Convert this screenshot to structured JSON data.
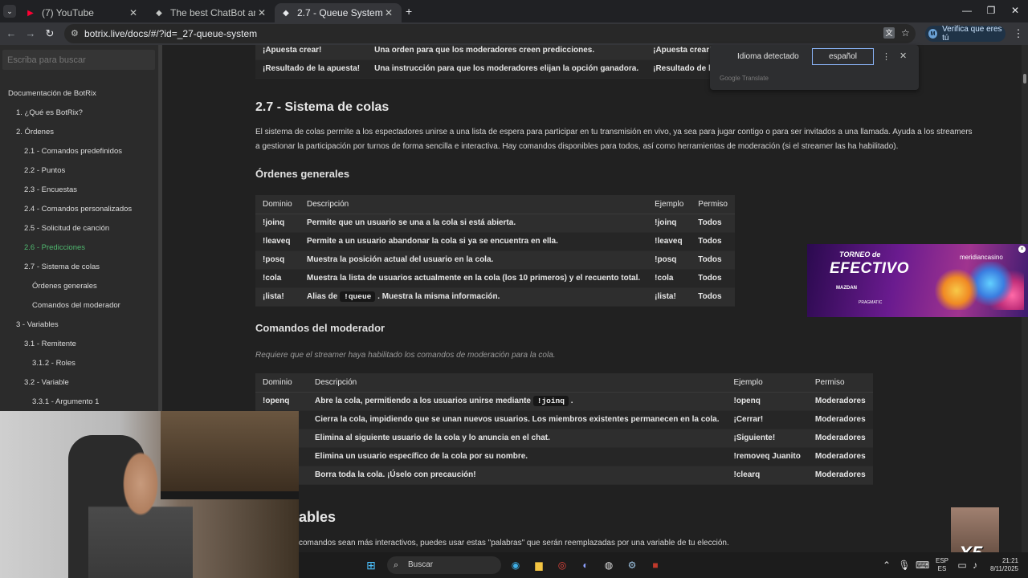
{
  "browser": {
    "tabs": [
      {
        "title": "(7) YouTube",
        "favicon": "youtube-icon",
        "active": false
      },
      {
        "title": "The best ChatBot and Widgets",
        "favicon": "botrix-icon",
        "active": false
      },
      {
        "title": "2.7 - Queue System",
        "favicon": "botrix-icon",
        "active": true
      }
    ],
    "url": "botrix.live/docs/#/?id=_27-queue-system",
    "verify_label": "Verifica que eres tú",
    "verify_avatar": "M"
  },
  "translate": {
    "detected": "Idioma detectado",
    "target": "español",
    "brand": "Google Translate"
  },
  "sidebar": {
    "search_placeholder": "Escriba para buscar",
    "items": [
      {
        "label": "Documentación de BotRix",
        "level": 0
      },
      {
        "label": "1. ¿Qué es BotRix?",
        "level": 1
      },
      {
        "label": "2. Órdenes",
        "level": 1
      },
      {
        "label": "2.1 - Comandos predefinidos",
        "level": 2
      },
      {
        "label": "2.2 - Puntos",
        "level": 2
      },
      {
        "label": "2.3 - Encuestas",
        "level": 2
      },
      {
        "label": "2.4 - Comandos personalizados",
        "level": 2
      },
      {
        "label": "2.5 - Solicitud de canción",
        "level": 2
      },
      {
        "label": "2.6 - Predicciones",
        "level": 2,
        "active": true
      },
      {
        "label": "2.7 - Sistema de colas",
        "level": 2
      },
      {
        "label": "Órdenes generales",
        "level": 3
      },
      {
        "label": "Comandos del moderador",
        "level": 3
      },
      {
        "label": "3 - Variables",
        "level": 1
      },
      {
        "label": "3.1 - Remitente",
        "level": 2
      },
      {
        "label": "3.1.2 - Roles",
        "level": 3
      },
      {
        "label": "3.2 - Variable",
        "level": 2
      },
      {
        "label": "3.3.1 - Argumento 1",
        "level": 3
      }
    ]
  },
  "content": {
    "prev_table_rows": [
      [
        "¡Apuesta crear!",
        "Una orden para que los moderadores creen predicciones.",
        "¡Apuesta crear!"
      ],
      [
        "¡Resultado de la apuesta!",
        "Una instrucción para que los moderadores elijan la opción ganadora.",
        "¡Resultado de la apuesta! Y"
      ]
    ],
    "section_title": "2.7 - Sistema de colas",
    "intro_line1": "El sistema de colas permite a los espectadores unirse a una lista de espera para participar en tu transmisión en vivo, ya sea para jugar contigo o para ser invitados a una llamada. Ayuda a los streamers",
    "intro_line2": "a gestionar la participación por turnos de forma sencilla e interactiva. Hay comandos disponibles para todos, así como herramientas de moderación (si el streamer las ha habilitado).",
    "general_title": "Órdenes generales",
    "general_headers": [
      "Dominio",
      "Descripción",
      "Ejemplo",
      "Permiso"
    ],
    "general_rows": [
      {
        "cmd": "!joinq",
        "desc": "Permite que un usuario se una a la cola si está abierta.",
        "ex": "!joinq",
        "perm": "Todos"
      },
      {
        "cmd": "!leaveq",
        "desc": "Permite a un usuario abandonar la cola si ya se encuentra en ella.",
        "ex": "!leaveq",
        "perm": "Todos"
      },
      {
        "cmd": "!posq",
        "desc": "Muestra la posición actual del usuario en la cola.",
        "ex": "!posq",
        "perm": "Todos"
      },
      {
        "cmd": "!cola",
        "desc": "Muestra la lista de usuarios actualmente en la cola (los 10 primeros) y el recuento total.",
        "ex": "!cola",
        "perm": "Todos"
      },
      {
        "cmd": "¡lista!",
        "desc_pre": "Alias de",
        "desc_code": "!queue",
        "desc_post": ". Muestra la misma información.",
        "ex": "¡lista!",
        "perm": "Todos"
      }
    ],
    "mod_title": "Comandos del moderador",
    "mod_note": "Requiere que el streamer haya habilitado los comandos de moderación para la cola.",
    "mod_headers": [
      "Dominio",
      "Descripción",
      "Ejemplo",
      "Permiso"
    ],
    "mod_rows": [
      {
        "cmd": "!openq",
        "desc_pre": "Abre la cola, permitiendo a los usuarios unirse mediante",
        "desc_code": "!joinq",
        "desc_post": ".",
        "ex": "!openq",
        "perm": "Moderadores"
      },
      {
        "cmd": "",
        "desc": "Cierra la cola, impidiendo que se unan nuevos usuarios. Los miembros existentes permanecen en la cola.",
        "ex": "¡Cerrar!",
        "perm": "Moderadores"
      },
      {
        "cmd": "",
        "desc": "Elimina al siguiente usuario de la cola y lo anuncia en el chat.",
        "ex": "¡Siguiente!",
        "perm": "Moderadores"
      },
      {
        "cmd": "",
        "desc": "Elimina un usuario específico de la cola por su nombre.",
        "ex": "!removeq Juanito",
        "perm": "Moderadores"
      },
      {
        "cmd": "",
        "desc": "Borra toda la cola. ¡Úselo con precaución!",
        "ex": "!clearq",
        "perm": "Moderadores"
      }
    ],
    "variables_title_partial": "ables",
    "variables_intro_partial": "comandos sean más interactivos, puedes usar estas \"palabras\" que serán reemplazadas por una variable de tu elección."
  },
  "ad": {
    "line1": "TORNEO de",
    "line2": "EFECTIVO",
    "brand": "meridiancasino",
    "sponsor1": "MAZDAN",
    "sponsor2": "PRAGMATIC"
  },
  "meme": {
    "label": "X5"
  },
  "taskbar": {
    "search_label": "Buscar",
    "lang_top": "ESP",
    "lang_bottom": "ES",
    "time": "21:21",
    "date": "8/11/2025"
  },
  "colors": {
    "accent_active": "#4fb86f",
    "page_bg": "#212121",
    "sidebar_bg": "#2b2b2b"
  }
}
